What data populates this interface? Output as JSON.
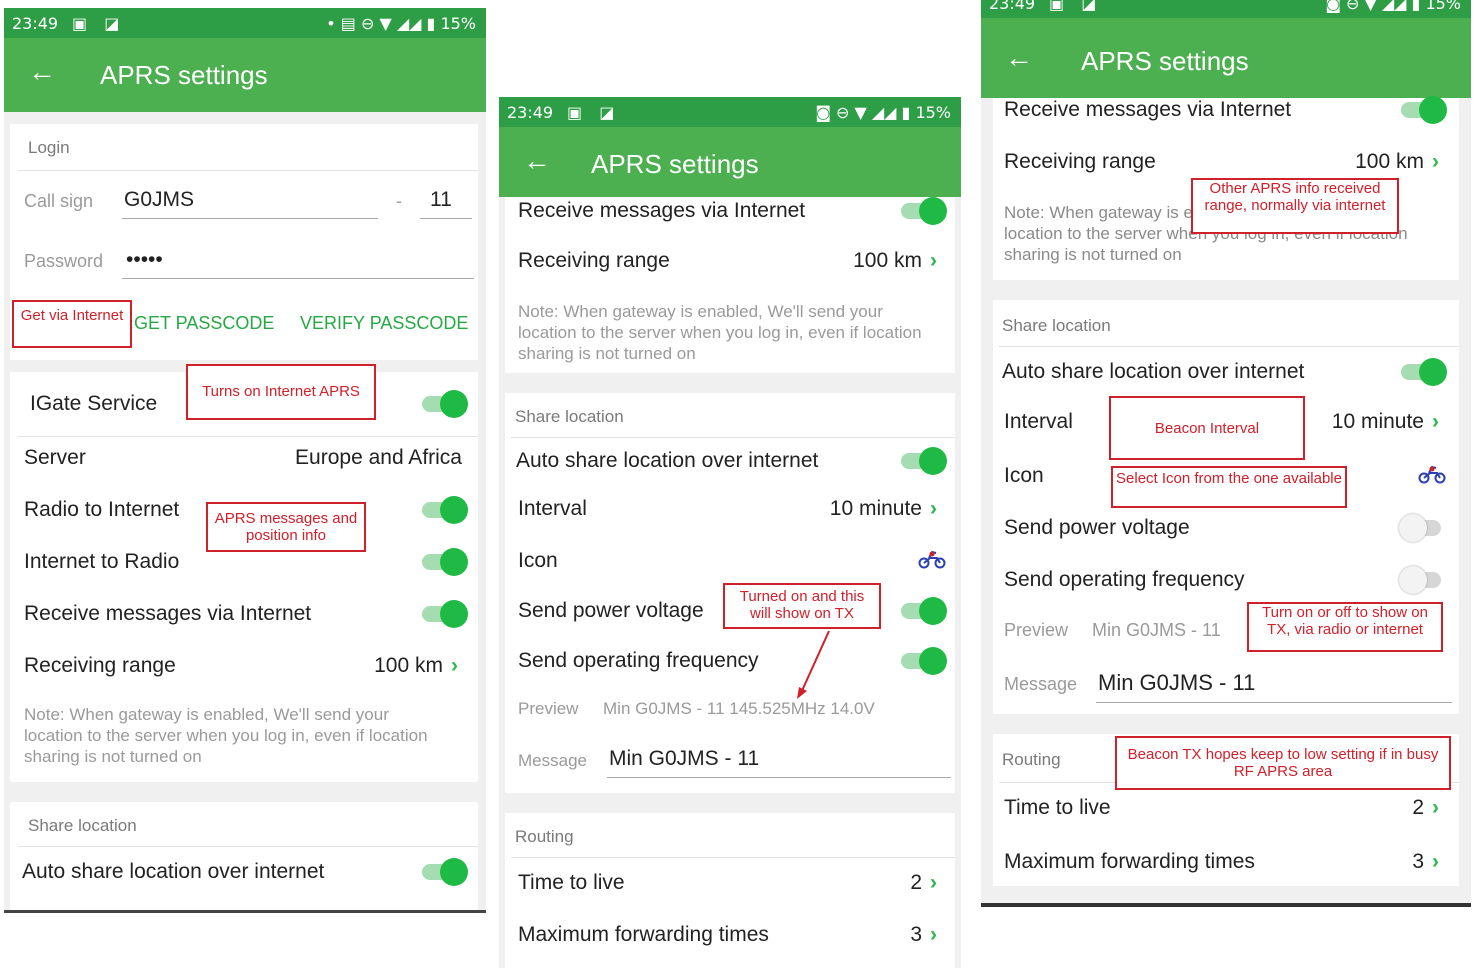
{
  "status": {
    "time": "23:49",
    "battery": "15%",
    "left_icons": "▣ ◪",
    "right_icons_1": "• ▤ ⊖ ▼ ◢◢ ▮",
    "right_icons_2": "◙ ⊖ ▼ ◢◢ ▮"
  },
  "appbar": {
    "title": "APRS settings",
    "back": "←"
  },
  "chevron": "›",
  "s1": {
    "login_header": "Login",
    "callsign_label": "Call sign",
    "callsign_value": "G0JMS",
    "ssid_dash": "-",
    "ssid_value": "11",
    "password_label": "Password",
    "password_value": "•••••",
    "get_passcode": "GET PASSCODE",
    "verify_passcode": "VERIFY PASSCODE",
    "igate": "IGate Service",
    "server_label": "Server",
    "server_value": "Europe and Africa",
    "radio_to_internet": "Radio to Internet",
    "internet_to_radio": "Internet to Radio",
    "receive_messages": "Receive messages via Internet",
    "receiving_range": "Receiving range",
    "receiving_range_value": "100 km",
    "note": "Note: When gateway is enabled, We'll send your location to the server when you log in, even if location sharing is not turned on",
    "share_header": "Share location",
    "auto_share": "Auto share location over internet",
    "ann_get": "Get via Internet",
    "ann_igate": "Turns on Internet APRS",
    "ann_msgs": "APRS messages and position info"
  },
  "s2": {
    "receive_messages": "Receive messages via Internet",
    "receiving_range": "Receiving range",
    "receiving_range_value": "100 km",
    "note": "Note: When gateway is enabled, We'll send your location to the server when you log in, even if location sharing is not turned on",
    "share_header": "Share location",
    "auto_share": "Auto share location over internet",
    "interval": "Interval",
    "interval_value": "10 minute",
    "icon": "Icon",
    "send_power": "Send power voltage",
    "send_freq": "Send operating frequency",
    "preview_label": "Preview",
    "preview_value": "Min G0JMS - 11 145.525MHz 14.0V",
    "message_label": "Message",
    "message_value": "Min G0JMS - 11",
    "routing_header": "Routing",
    "ttl": "Time to live",
    "ttl_value": "2",
    "max_fwd": "Maximum forwarding times",
    "max_fwd_value": "3",
    "ann_turned": "Turned on and this will show on TX"
  },
  "s3": {
    "receive_messages": "Receive messages via Internet",
    "receiving_range": "Receiving range",
    "receiving_range_value": "100 km",
    "note": "Note: When gateway is enabled, We'll send your location to the server when you log in, even if location sharing is not turned on",
    "share_header": "Share location",
    "auto_share": "Auto share location over internet",
    "interval": "Interval",
    "interval_value": "10 minute",
    "icon": "Icon",
    "send_power": "Send power voltage",
    "send_freq": "Send operating frequency",
    "preview_label": "Preview",
    "preview_value": "Min G0JMS - 11",
    "message_label": "Message",
    "message_value": "Min G0JMS - 11",
    "routing_header": "Routing",
    "ttl": "Time to live",
    "ttl_value": "2",
    "max_fwd": "Maximum forwarding times",
    "max_fwd_value": "3",
    "ann_range": "Other APRS info received range, normally via internet",
    "ann_interval": "Beacon Interval",
    "ann_icon": "Select Icon from the one available",
    "ann_turn": "Turn on or off to show on TX, via radio or internet",
    "ann_routing": "Beacon TX hopes keep to low setting if in busy RF APRS area"
  },
  "colors": {
    "primary": "#4caf50",
    "status": "#2e9e46",
    "accent": "#1fba45",
    "annotation": "#d0202a"
  }
}
